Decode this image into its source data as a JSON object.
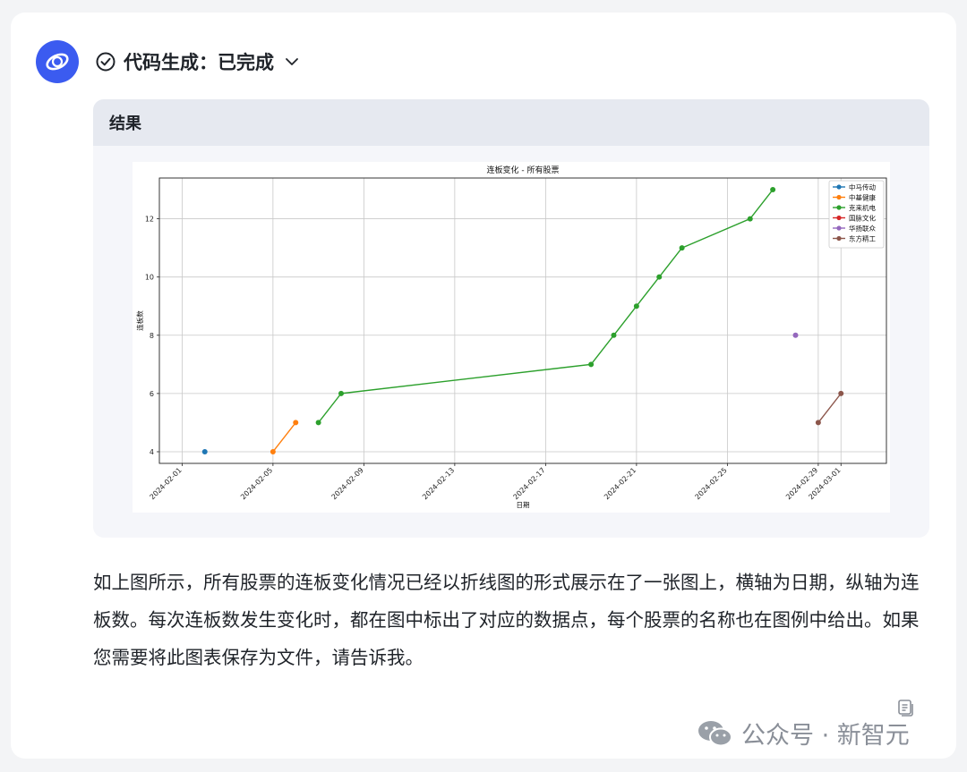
{
  "status": {
    "label": "代码生成：已完成",
    "icons": [
      "check-circle-icon",
      "chevron-down-icon"
    ]
  },
  "result": {
    "header": "结果"
  },
  "chart_data": {
    "type": "line",
    "title": "连板变化 - 所有股票",
    "xlabel": "日期",
    "ylabel": "连板数",
    "x_ticks": [
      "2024-02-01",
      "2024-02-05",
      "2024-02-09",
      "2024-02-13",
      "2024-02-17",
      "2024-02-21",
      "2024-02-25",
      "2024-02-29",
      "2024-03-01"
    ],
    "y_ticks": [
      4,
      6,
      8,
      10,
      12
    ],
    "xlim": [
      "2024-01-31",
      "2024-03-03"
    ],
    "ylim": [
      3.6,
      13.4
    ],
    "grid": true,
    "legend_position": "top-right",
    "series": [
      {
        "name": "中马传动",
        "color": "#1f77b4",
        "points": [
          [
            "2024-02-02",
            4
          ]
        ]
      },
      {
        "name": "中基健康",
        "color": "#ff7f0e",
        "points": [
          [
            "2024-02-05",
            4
          ],
          [
            "2024-02-06",
            5
          ]
        ]
      },
      {
        "name": "克来机电",
        "color": "#2ca02c",
        "points": [
          [
            "2024-02-07",
            5
          ],
          [
            "2024-02-08",
            6
          ],
          [
            "2024-02-19",
            7
          ],
          [
            "2024-02-20",
            8
          ],
          [
            "2024-02-21",
            9
          ],
          [
            "2024-02-22",
            10
          ],
          [
            "2024-02-23",
            11
          ],
          [
            "2024-02-26",
            12
          ],
          [
            "2024-02-27",
            13
          ]
        ]
      },
      {
        "name": "国脉文化",
        "color": "#d62728",
        "points": []
      },
      {
        "name": "华扬联众",
        "color": "#9467bd",
        "points": [
          [
            "2024-02-28",
            8
          ]
        ]
      },
      {
        "name": "东方精工",
        "color": "#8c564b",
        "points": [
          [
            "2024-02-29",
            5
          ],
          [
            "2024-03-01",
            6
          ]
        ]
      }
    ]
  },
  "paragraph": "如上图所示，所有股票的连板变化情况已经以折线图的形式展示在了一张图上，横轴为日期，纵轴为连板数。每次连板数发生变化时，都在图中标出了对应的数据点，每个股票的名称也在图例中给出。如果您需要将此图表保存为文件，请告诉我。",
  "watermark": {
    "text": "公众号 · 新智元",
    "icon": "wechat-icon"
  },
  "colors": {
    "avatar_bg": "#3b5bf0",
    "header_bg": "#e6e9f0",
    "page_bg": "#f3f4f6"
  }
}
